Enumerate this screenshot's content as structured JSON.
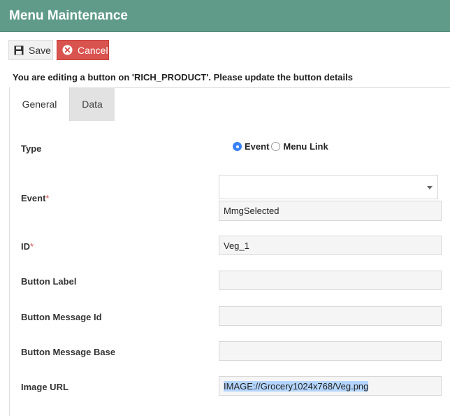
{
  "header": {
    "title": "Menu Maintenance"
  },
  "toolbar": {
    "save_label": "Save",
    "cancel_label": "Cancel"
  },
  "notice": "You are editing a button on 'RICH_PRODUCT'. Please update the button details",
  "tabs": [
    {
      "label": "General",
      "active": true
    },
    {
      "label": "Data",
      "active": false
    }
  ],
  "form": {
    "type": {
      "label": "Type",
      "options": [
        "Event",
        "Menu Link"
      ],
      "selected": "Event"
    },
    "event": {
      "label": "Event",
      "required_mark": "*",
      "select_value": "",
      "value": "MmgSelected"
    },
    "id": {
      "label": "ID",
      "required_mark": "*",
      "value": "Veg_1"
    },
    "button_label": {
      "label": "Button Label",
      "value": ""
    },
    "button_message_id": {
      "label": "Button Message Id",
      "value": ""
    },
    "button_message_base": {
      "label": "Button Message Base",
      "value": ""
    },
    "image_url": {
      "label": "Image URL",
      "value": "IMAGE://Grocery1024x768/Veg.png"
    }
  },
  "colors": {
    "header": "#5f9b88",
    "cancel": "#d9534f",
    "radio_active": "#3b82f6",
    "required": "#d9534f"
  }
}
